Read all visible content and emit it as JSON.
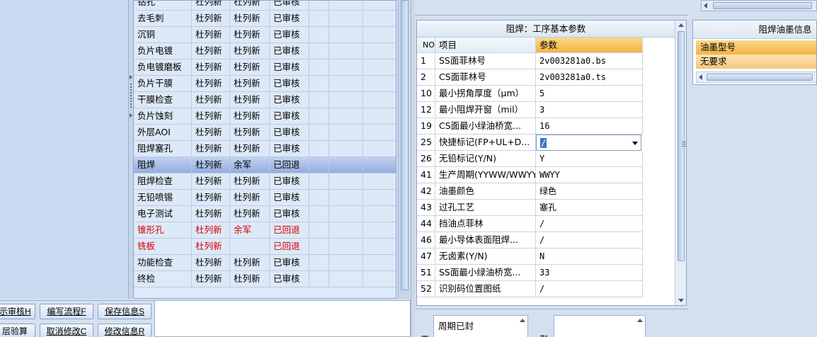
{
  "process_grid": {
    "rows": [
      {
        "name": "钻孔",
        "c1": "杜列新",
        "c2": "杜列新",
        "status": "已审核",
        "style": "normal"
      },
      {
        "name": "去毛刺",
        "c1": "杜列新",
        "c2": "杜列新",
        "status": "已审核",
        "style": "normal"
      },
      {
        "name": "沉铜",
        "c1": "杜列新",
        "c2": "杜列新",
        "status": "已审核",
        "style": "normal"
      },
      {
        "name": "负片电镀",
        "c1": "杜列新",
        "c2": "杜列新",
        "status": "已审核",
        "style": "normal"
      },
      {
        "name": "负电镀磨板",
        "c1": "杜列新",
        "c2": "杜列新",
        "status": "已审核",
        "style": "normal"
      },
      {
        "name": "负片干膜",
        "c1": "杜列新",
        "c2": "杜列新",
        "status": "已审核",
        "style": "normal"
      },
      {
        "name": "干膜检查",
        "c1": "杜列新",
        "c2": "杜列新",
        "status": "已审核",
        "style": "normal"
      },
      {
        "name": "负片蚀刻",
        "c1": "杜列新",
        "c2": "杜列新",
        "status": "已审核",
        "style": "normal"
      },
      {
        "name": "外层AOI",
        "c1": "杜列新",
        "c2": "杜列新",
        "status": "已审核",
        "style": "normal"
      },
      {
        "name": "阻焊塞孔",
        "c1": "杜列新",
        "c2": "杜列新",
        "status": "已审核",
        "style": "normal"
      },
      {
        "name": "阻焊",
        "c1": "杜列新",
        "c2": "余军",
        "status": "已回退",
        "style": "selected"
      },
      {
        "name": "阻焊检查",
        "c1": "杜列新",
        "c2": "杜列新",
        "status": "已审核",
        "style": "normal"
      },
      {
        "name": "无铅喷锡",
        "c1": "杜列新",
        "c2": "杜列新",
        "status": "已审核",
        "style": "normal"
      },
      {
        "name": "电子测试",
        "c1": "杜列新",
        "c2": "杜列新",
        "status": "已审核",
        "style": "normal"
      },
      {
        "name": "锥形孔",
        "c1": "杜列新",
        "c2": "余军",
        "status": "已回退",
        "style": "red"
      },
      {
        "name": "铣板",
        "c1": "杜列新",
        "c2": "",
        "status": "已回退",
        "style": "red"
      },
      {
        "name": "功能检查",
        "c1": "杜列新",
        "c2": "杜列新",
        "status": "已审核",
        "style": "normal"
      },
      {
        "name": "终检",
        "c1": "杜列新",
        "c2": "杜列新",
        "status": "已审核",
        "style": "normal"
      }
    ]
  },
  "toolbar": {
    "review_label": "示审核H",
    "review_key": "H",
    "edit_flow_label": "编写流程F",
    "edit_flow_key": "F",
    "save_info_label": "保存信息S",
    "save_info_key": "S",
    "layer_check_label": "层验算",
    "cancel_edit_label": "取消修改C",
    "cancel_edit_key": "C",
    "modify_info_label": "修改信息R",
    "modify_info_key": "R"
  },
  "param_panel": {
    "title": "阻焊：工序基本参数",
    "headers": {
      "no": "NO",
      "item": "项目",
      "param": "参数"
    },
    "rows": [
      {
        "no": "1",
        "item": "SS面菲林号",
        "value": "2v003281a0.bs"
      },
      {
        "no": "2",
        "item": "CS面菲林号",
        "value": "2v003281a0.ts"
      },
      {
        "no": "10",
        "item": "最小拐角厚度（μm）",
        "value": "5"
      },
      {
        "no": "12",
        "item": "最小阻焊开窗（mil）",
        "value": "3"
      },
      {
        "no": "19",
        "item": "CS面最小绿油桥宽...",
        "value": "16"
      },
      {
        "no": "25",
        "item": "快捷标记(FP+UL+D...",
        "value": "/",
        "combo": true
      },
      {
        "no": "26",
        "item": "无铅标记(Y/N)",
        "value": "Y"
      },
      {
        "no": "41",
        "item": "生产周期(YYWW/WWYY)",
        "value": "WWYY"
      },
      {
        "no": "42",
        "item": "油墨颜色",
        "value": "绿色"
      },
      {
        "no": "43",
        "item": "过孔工艺",
        "value": "塞孔"
      },
      {
        "no": "44",
        "item": "挡油点菲林",
        "value": "/"
      },
      {
        "no": "46",
        "item": "最小导体表面阻焊...",
        "value": "/"
      },
      {
        "no": "47",
        "item": "无卤素(Y/N)",
        "value": "N"
      },
      {
        "no": "51",
        "item": "SS面最小绿油桥宽...",
        "value": "33"
      },
      {
        "no": "52",
        "item": "识别码位置图纸",
        "value": "/"
      }
    ]
  },
  "ink_panel": {
    "title": "阻焊油墨信息",
    "header": "油墨型号",
    "row_value": "无要求"
  },
  "bottom_mid": {
    "gong_label": "工",
    "cycle_value": "周期已封",
    "xing_label": "型"
  }
}
